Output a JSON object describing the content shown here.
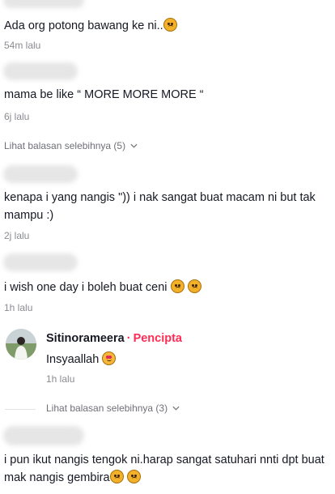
{
  "comments": [
    {
      "text": "Ada org potong bawang ke ni..",
      "emoji": [
        "confused-face-emoji"
      ],
      "time": "54m lalu"
    },
    {
      "text": "mama be like “ MORE MORE MORE “",
      "time": "6j lalu",
      "more": "Lihat balasan selebihnya (5)"
    },
    {
      "text": "kenapa i yang nangis \")) i nak sangat buat macam ni but tak mampu :)",
      "time": "2j lalu"
    },
    {
      "text": "i wish one day i boleh buat ceni",
      "emoji": [
        "confused-face-emoji",
        "confused-face-emoji"
      ],
      "time": "1h lalu"
    },
    {
      "text": "i pun ikut nangis tengok ni.harap sangat satuhari nnti dpt buat mak nangis gembira",
      "emoji": [
        "frowning-face-emoji",
        "confounded-face-emoji"
      ]
    }
  ],
  "reply": {
    "author": "Sitinorameera",
    "separator": "·",
    "badge": "Pencipta",
    "text": "Insyaallah",
    "emoji": [
      "smiling-face-with-hearts-emoji"
    ],
    "time": "1h lalu",
    "more": "Lihat balasan selebihnya (3)"
  },
  "colors": {
    "accent": "#fe2c55",
    "muted": "#8a8b91",
    "text": "#161823"
  }
}
